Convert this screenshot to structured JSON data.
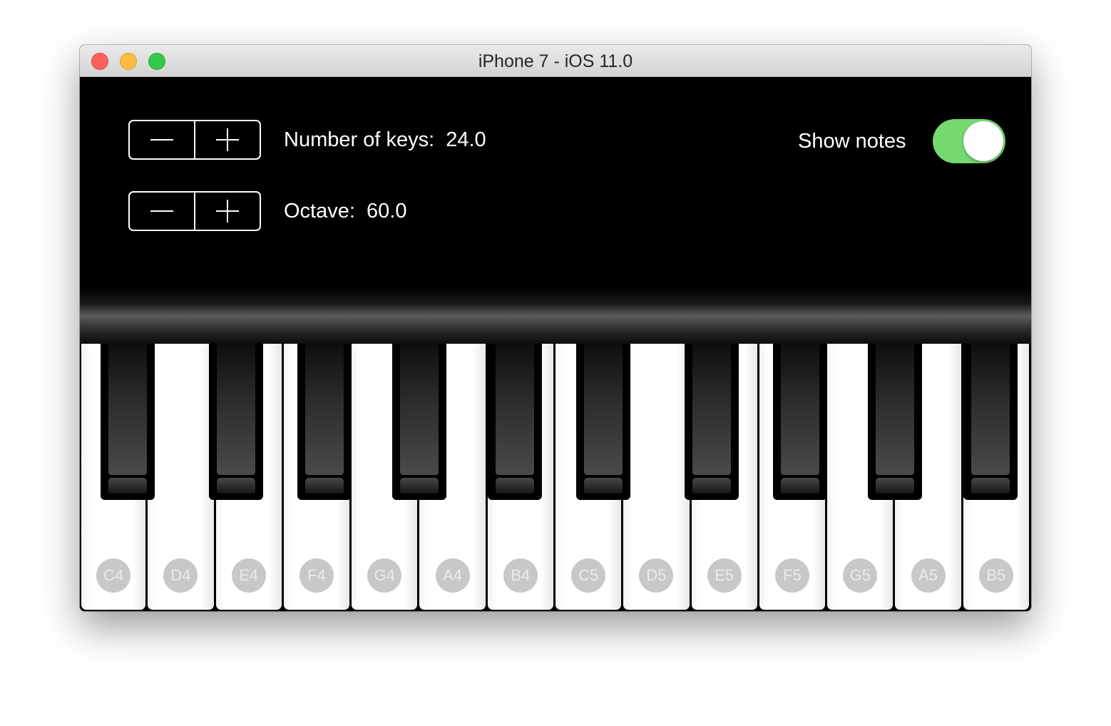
{
  "window": {
    "title": "iPhone 7 - iOS 11.0"
  },
  "controls": {
    "keys_stepper": {
      "minus_icon": "minus-icon",
      "plus_icon": "plus-icon"
    },
    "keys_label": "Number of keys:  24.0",
    "octave_stepper": {
      "minus_icon": "minus-icon",
      "plus_icon": "plus-icon"
    },
    "octave_label": "Octave:  60.0",
    "show_notes_label": "Show notes",
    "show_notes_on": true
  },
  "colors": {
    "toggle_on": "#75d970",
    "close": "#fc605c",
    "minimize": "#fdbc40",
    "zoom": "#34c84a"
  },
  "piano": {
    "white_keys": [
      "C4",
      "D4",
      "E4",
      "F4",
      "G4",
      "A4",
      "B4",
      "C5",
      "D5",
      "E5",
      "F5",
      "G5",
      "A5",
      "B5"
    ],
    "black_keys": [
      "C#4",
      "D#4",
      "F#4",
      "G#4",
      "A#4",
      "C#5",
      "D#5",
      "F#5",
      "G#5",
      "A#5"
    ]
  }
}
